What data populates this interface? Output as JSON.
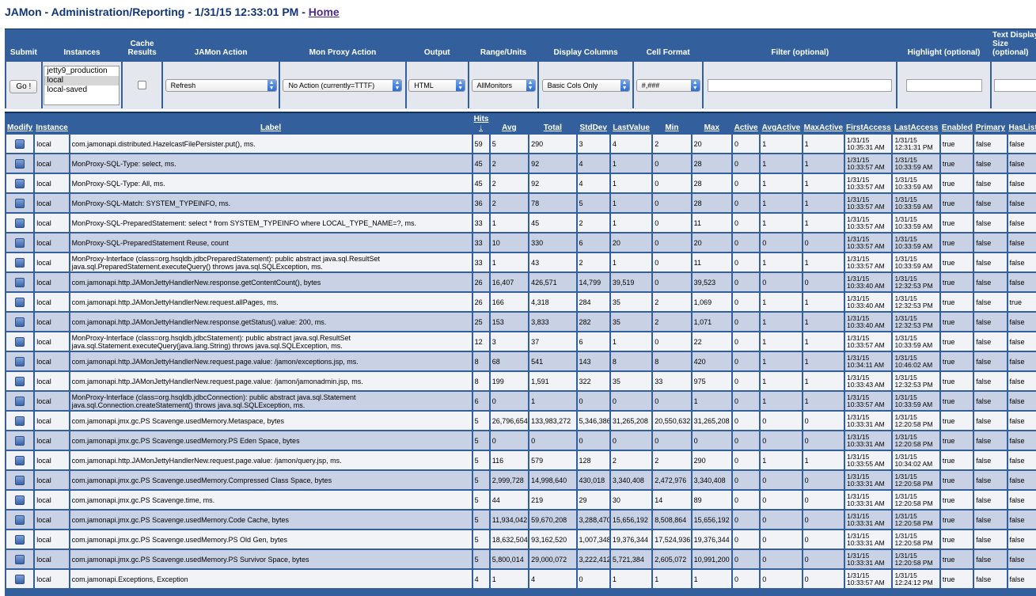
{
  "header": {
    "title": "JAMon - Administration/Reporting - 1/31/15 12:33:01 PM - ",
    "home_link": "Home"
  },
  "controls": {
    "headers": [
      "Submit",
      "Instances",
      "Cache Results",
      "JAMon Action",
      "Mon Proxy Action",
      "Output",
      "Range/Units",
      "Display Columns",
      "Cell Format",
      "Filter (optional)",
      "Highlight (optional)",
      "Text Display Size (optional)"
    ],
    "go_label": "Go !",
    "instances": [
      "jetty9_production",
      "local",
      "local-saved"
    ],
    "selected_instance": "local",
    "cache_results_checked": false,
    "jamon_action": "Refresh",
    "mon_proxy_action": "No Action (currently=TTTF)",
    "output": "HTML",
    "range_units": "AllMonitors",
    "display_columns": "Basic Cols Only",
    "cell_format": "#,###",
    "filter_value": "",
    "highlight_value": "",
    "text_display_size_value": ""
  },
  "table": {
    "columns": [
      "Modify",
      "Instance",
      "Label",
      "Hits",
      "Avg",
      "Total",
      "StdDev",
      "LastValue",
      "Min",
      "Max",
      "Active",
      "AvgActive",
      "MaxActive",
      "FirstAccess",
      "LastAccess",
      "Enabled",
      "Primary",
      "HasListeners"
    ],
    "hits_sort_arrow": "↓",
    "rows": [
      [
        "local",
        "com.jamonapi.distributed.HazelcastFilePersister.put(), ms.",
        "59",
        "5",
        "290",
        "3",
        "4",
        "2",
        "20",
        "0",
        "1",
        "1",
        "1/31/15 10:35:31 AM",
        "1/31/15 12:31:31 PM",
        "true",
        "false",
        "false"
      ],
      [
        "local",
        "MonProxy-SQL-Type: select, ms.",
        "45",
        "2",
        "92",
        "4",
        "1",
        "0",
        "28",
        "0",
        "1",
        "1",
        "1/31/15 10:33:57 AM",
        "1/31/15 10:33:59 AM",
        "true",
        "false",
        "false"
      ],
      [
        "local",
        "MonProxy-SQL-Type: All, ms.",
        "45",
        "2",
        "92",
        "4",
        "1",
        "0",
        "28",
        "0",
        "1",
        "1",
        "1/31/15 10:33:57 AM",
        "1/31/15 10:33:59 AM",
        "true",
        "false",
        "false"
      ],
      [
        "local",
        "MonProxy-SQL-Match: SYSTEM_TYPEINFO, ms.",
        "36",
        "2",
        "78",
        "5",
        "1",
        "0",
        "28",
        "0",
        "1",
        "1",
        "1/31/15 10:33:57 AM",
        "1/31/15 10:33:59 AM",
        "true",
        "false",
        "false"
      ],
      [
        "local",
        "MonProxy-SQL-PreparedStatement: select * from SYSTEM_TYPEINFO where LOCAL_TYPE_NAME=?, ms.",
        "33",
        "1",
        "45",
        "2",
        "1",
        "0",
        "11",
        "0",
        "1",
        "1",
        "1/31/15 10:33:57 AM",
        "1/31/15 10:33:59 AM",
        "true",
        "false",
        "false"
      ],
      [
        "local",
        "MonProxy-SQL-PreparedStatement Reuse, count",
        "33",
        "10",
        "330",
        "6",
        "20",
        "0",
        "20",
        "0",
        "0",
        "0",
        "1/31/15 10:33:57 AM",
        "1/31/15 10:33:59 AM",
        "true",
        "false",
        "false"
      ],
      [
        "local",
        "MonProxy-Interface (class=org.hsqldb.jdbcPreparedStatement): public abstract java.sql.ResultSet java.sql.PreparedStatement.executeQuery() throws java.sql.SQLException, ms.",
        "33",
        "1",
        "43",
        "2",
        "1",
        "0",
        "11",
        "0",
        "1",
        "1",
        "1/31/15 10:33:57 AM",
        "1/31/15 10:33:59 AM",
        "true",
        "false",
        "false"
      ],
      [
        "local",
        "com.jamonapi.http.JAMonJettyHandlerNew.response.getContentCount(), bytes",
        "26",
        "16,407",
        "426,571",
        "14,799",
        "39,519",
        "0",
        "39,523",
        "0",
        "0",
        "0",
        "1/31/15 10:33:40 AM",
        "1/31/15 12:32:53 PM",
        "true",
        "false",
        "false"
      ],
      [
        "local",
        "com.jamonapi.http.JAMonJettyHandlerNew.request.allPages, ms.",
        "26",
        "166",
        "4,318",
        "284",
        "35",
        "2",
        "1,069",
        "0",
        "1",
        "1",
        "1/31/15 10:33:40 AM",
        "1/31/15 12:32:53 PM",
        "true",
        "false",
        "true"
      ],
      [
        "local",
        "com.jamonapi.http.JAMonJettyHandlerNew.response.getStatus().value: 200, ms.",
        "25",
        "153",
        "3,833",
        "282",
        "35",
        "2",
        "1,071",
        "0",
        "1",
        "1",
        "1/31/15 10:33:40 AM",
        "1/31/15 12:32:53 PM",
        "true",
        "false",
        "false"
      ],
      [
        "local",
        "MonProxy-Interface (class=org.hsqldb.jdbcStatement): public abstract java.sql.ResultSet java.sql.Statement.executeQuery(java.lang.String) throws java.sql.SQLException, ms.",
        "12",
        "3",
        "37",
        "6",
        "1",
        "0",
        "22",
        "0",
        "1",
        "1",
        "1/31/15 10:33:57 AM",
        "1/31/15 10:33:59 AM",
        "true",
        "false",
        "false"
      ],
      [
        "local",
        "com.jamonapi.http.JAMonJettyHandlerNew.request.page.value: /jamon/exceptions.jsp, ms.",
        "8",
        "68",
        "541",
        "143",
        "8",
        "8",
        "420",
        "0",
        "1",
        "1",
        "1/31/15 10:34:11 AM",
        "1/31/15 10:46:02 AM",
        "true",
        "false",
        "false"
      ],
      [
        "local",
        "com.jamonapi.http.JAMonJettyHandlerNew.request.page.value: /jamon/jamonadmin.jsp, ms.",
        "8",
        "199",
        "1,591",
        "322",
        "35",
        "33",
        "975",
        "0",
        "1",
        "1",
        "1/31/15 10:33:43 AM",
        "1/31/15 12:32:53 PM",
        "true",
        "false",
        "false"
      ],
      [
        "local",
        "MonProxy-Interface (class=org.hsqldb.jdbcConnection): public abstract java.sql.Statement java.sql.Connection.createStatement() throws java.sql.SQLException, ms.",
        "6",
        "0",
        "1",
        "0",
        "0",
        "0",
        "1",
        "0",
        "1",
        "1",
        "1/31/15 10:33:57 AM",
        "1/31/15 10:33:59 AM",
        "true",
        "false",
        "false"
      ],
      [
        "local",
        "com.jamonapi.jmx.gc.PS Scavenge.usedMemory.Metaspace, bytes",
        "5",
        "26,796,654",
        "133,983,272",
        "5,346,386",
        "31,265,208",
        "20,550,632",
        "31,265,208",
        "0",
        "0",
        "0",
        "1/31/15 10:33:31 AM",
        "1/31/15 12:20:58 PM",
        "true",
        "false",
        "false"
      ],
      [
        "local",
        "com.jamonapi.jmx.gc.PS Scavenge.usedMemory.PS Eden Space, bytes",
        "5",
        "0",
        "0",
        "0",
        "0",
        "0",
        "0",
        "0",
        "0",
        "0",
        "1/31/15 10:33:31 AM",
        "1/31/15 12:20:58 PM",
        "true",
        "false",
        "false"
      ],
      [
        "local",
        "com.jamonapi.http.JAMonJettyHandlerNew.request.page.value: /jamon/query.jsp, ms.",
        "5",
        "116",
        "579",
        "128",
        "2",
        "2",
        "290",
        "0",
        "1",
        "1",
        "1/31/15 10:33:55 AM",
        "1/31/15 10:34:02 AM",
        "true",
        "false",
        "false"
      ],
      [
        "local",
        "com.jamonapi.jmx.gc.PS Scavenge.usedMemory.Compressed Class Space, bytes",
        "5",
        "2,999,728",
        "14,998,640",
        "430,018",
        "3,340,408",
        "2,472,976",
        "3,340,408",
        "0",
        "0",
        "0",
        "1/31/15 10:33:31 AM",
        "1/31/15 12:20:58 PM",
        "true",
        "false",
        "false"
      ],
      [
        "local",
        "com.jamonapi.jmx.gc.PS Scavenge.time, ms.",
        "5",
        "44",
        "219",
        "29",
        "30",
        "14",
        "89",
        "0",
        "0",
        "0",
        "1/31/15 10:33:31 AM",
        "1/31/15 12:20:58 PM",
        "true",
        "false",
        "false"
      ],
      [
        "local",
        "com.jamonapi.jmx.gc.PS Scavenge.usedMemory.Code Cache, bytes",
        "5",
        "11,934,042",
        "59,670,208",
        "3,288,470",
        "15,656,192",
        "8,508,864",
        "15,656,192",
        "0",
        "0",
        "0",
        "1/31/15 10:33:31 AM",
        "1/31/15 12:20:58 PM",
        "true",
        "false",
        "false"
      ],
      [
        "local",
        "com.jamonapi.jmx.gc.PS Scavenge.usedMemory.PS Old Gen, bytes",
        "5",
        "18,632,504",
        "93,162,520",
        "1,007,348",
        "19,376,344",
        "17,524,936",
        "19,376,344",
        "0",
        "0",
        "0",
        "1/31/15 10:33:31 AM",
        "1/31/15 12:20:58 PM",
        "true",
        "false",
        "false"
      ],
      [
        "local",
        "com.jamonapi.jmx.gc.PS Scavenge.usedMemory.PS Survivor Space, bytes",
        "5",
        "5,800,014",
        "29,000,072",
        "3,222,412",
        "5,721,384",
        "2,605,072",
        "10,991,200",
        "0",
        "0",
        "0",
        "1/31/15 10:33:31 AM",
        "1/31/15 12:20:58 PM",
        "true",
        "false",
        "false"
      ],
      [
        "local",
        "com.jamonapi.Exceptions, Exception",
        "4",
        "1",
        "4",
        "0",
        "1",
        "1",
        "1",
        "0",
        "0",
        "0",
        "1/31/15 10:33:57 AM",
        "1/31/15 12:24:12 PM",
        "true",
        "false",
        "false"
      ]
    ]
  }
}
